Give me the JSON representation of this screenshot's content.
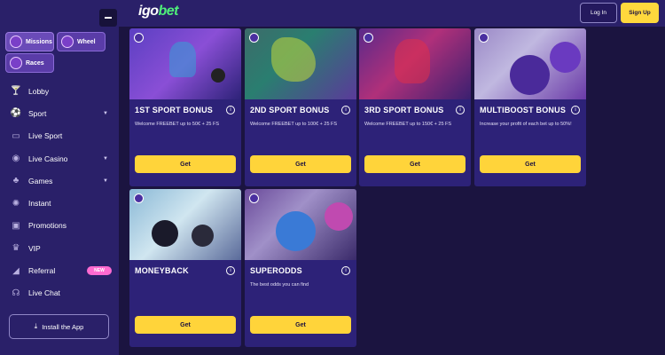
{
  "header": {
    "logo_left": "igo",
    "logo_right": "bet",
    "login_label": "Log In",
    "signup_label": "Sign Up"
  },
  "sidebar": {
    "chips": {
      "missions": "Missions",
      "wheel": "Wheel",
      "races": "Races"
    },
    "items": [
      {
        "label": "Lobby",
        "icon": "cocktail-icon",
        "glyph": "🍸",
        "chevron": false
      },
      {
        "label": "Sport",
        "icon": "soccer-ball-icon",
        "glyph": "⚽",
        "chevron": true
      },
      {
        "label": "Live Sport",
        "icon": "tv-icon",
        "glyph": "▭",
        "chevron": false
      },
      {
        "label": "Live Casino",
        "icon": "poker-chip-icon",
        "glyph": "◉",
        "chevron": true
      },
      {
        "label": "Games",
        "icon": "controller-icon",
        "glyph": "♣",
        "chevron": true
      },
      {
        "label": "Instant",
        "icon": "lightning-icon",
        "glyph": "✺",
        "chevron": false
      },
      {
        "label": "Promotions",
        "icon": "gift-icon",
        "glyph": "▣",
        "chevron": false
      },
      {
        "label": "VIP",
        "icon": "crown-icon",
        "glyph": "♛",
        "chevron": false
      },
      {
        "label": "Referral",
        "icon": "megaphone-icon",
        "glyph": "◢",
        "chevron": false,
        "badge": "NEW"
      },
      {
        "label": "Live Chat",
        "icon": "headset-icon",
        "glyph": "☊",
        "chevron": false
      }
    ],
    "install_label": "Install the App"
  },
  "cards": [
    {
      "title": "1ST SPORT BONUS",
      "desc": "Welcome FREEBET up to 50€ + 25 FS",
      "button": "Get"
    },
    {
      "title": "2ND SPORT BONUS",
      "desc": "Welcome FREEBET up to 100€ + 25 FS",
      "button": "Get"
    },
    {
      "title": "3RD SPORT BONUS",
      "desc": "Welcome FREEBET up to 150€ + 25 FS",
      "button": "Get"
    },
    {
      "title": "MULTIBOOST BONUS",
      "desc": "Increase your profit of each bet up to 50%!",
      "button": "Get"
    },
    {
      "title": "MONEYBACK",
      "desc": "",
      "button": "Get"
    },
    {
      "title": "SUPERODDS",
      "desc": "The best odds you can find",
      "button": "Get"
    }
  ],
  "colors": {
    "accent": "#ffd43a",
    "sidebar": "#2a2069",
    "card": "#2d2278",
    "background": "#1b1440",
    "logo_green": "#4ff07a"
  }
}
